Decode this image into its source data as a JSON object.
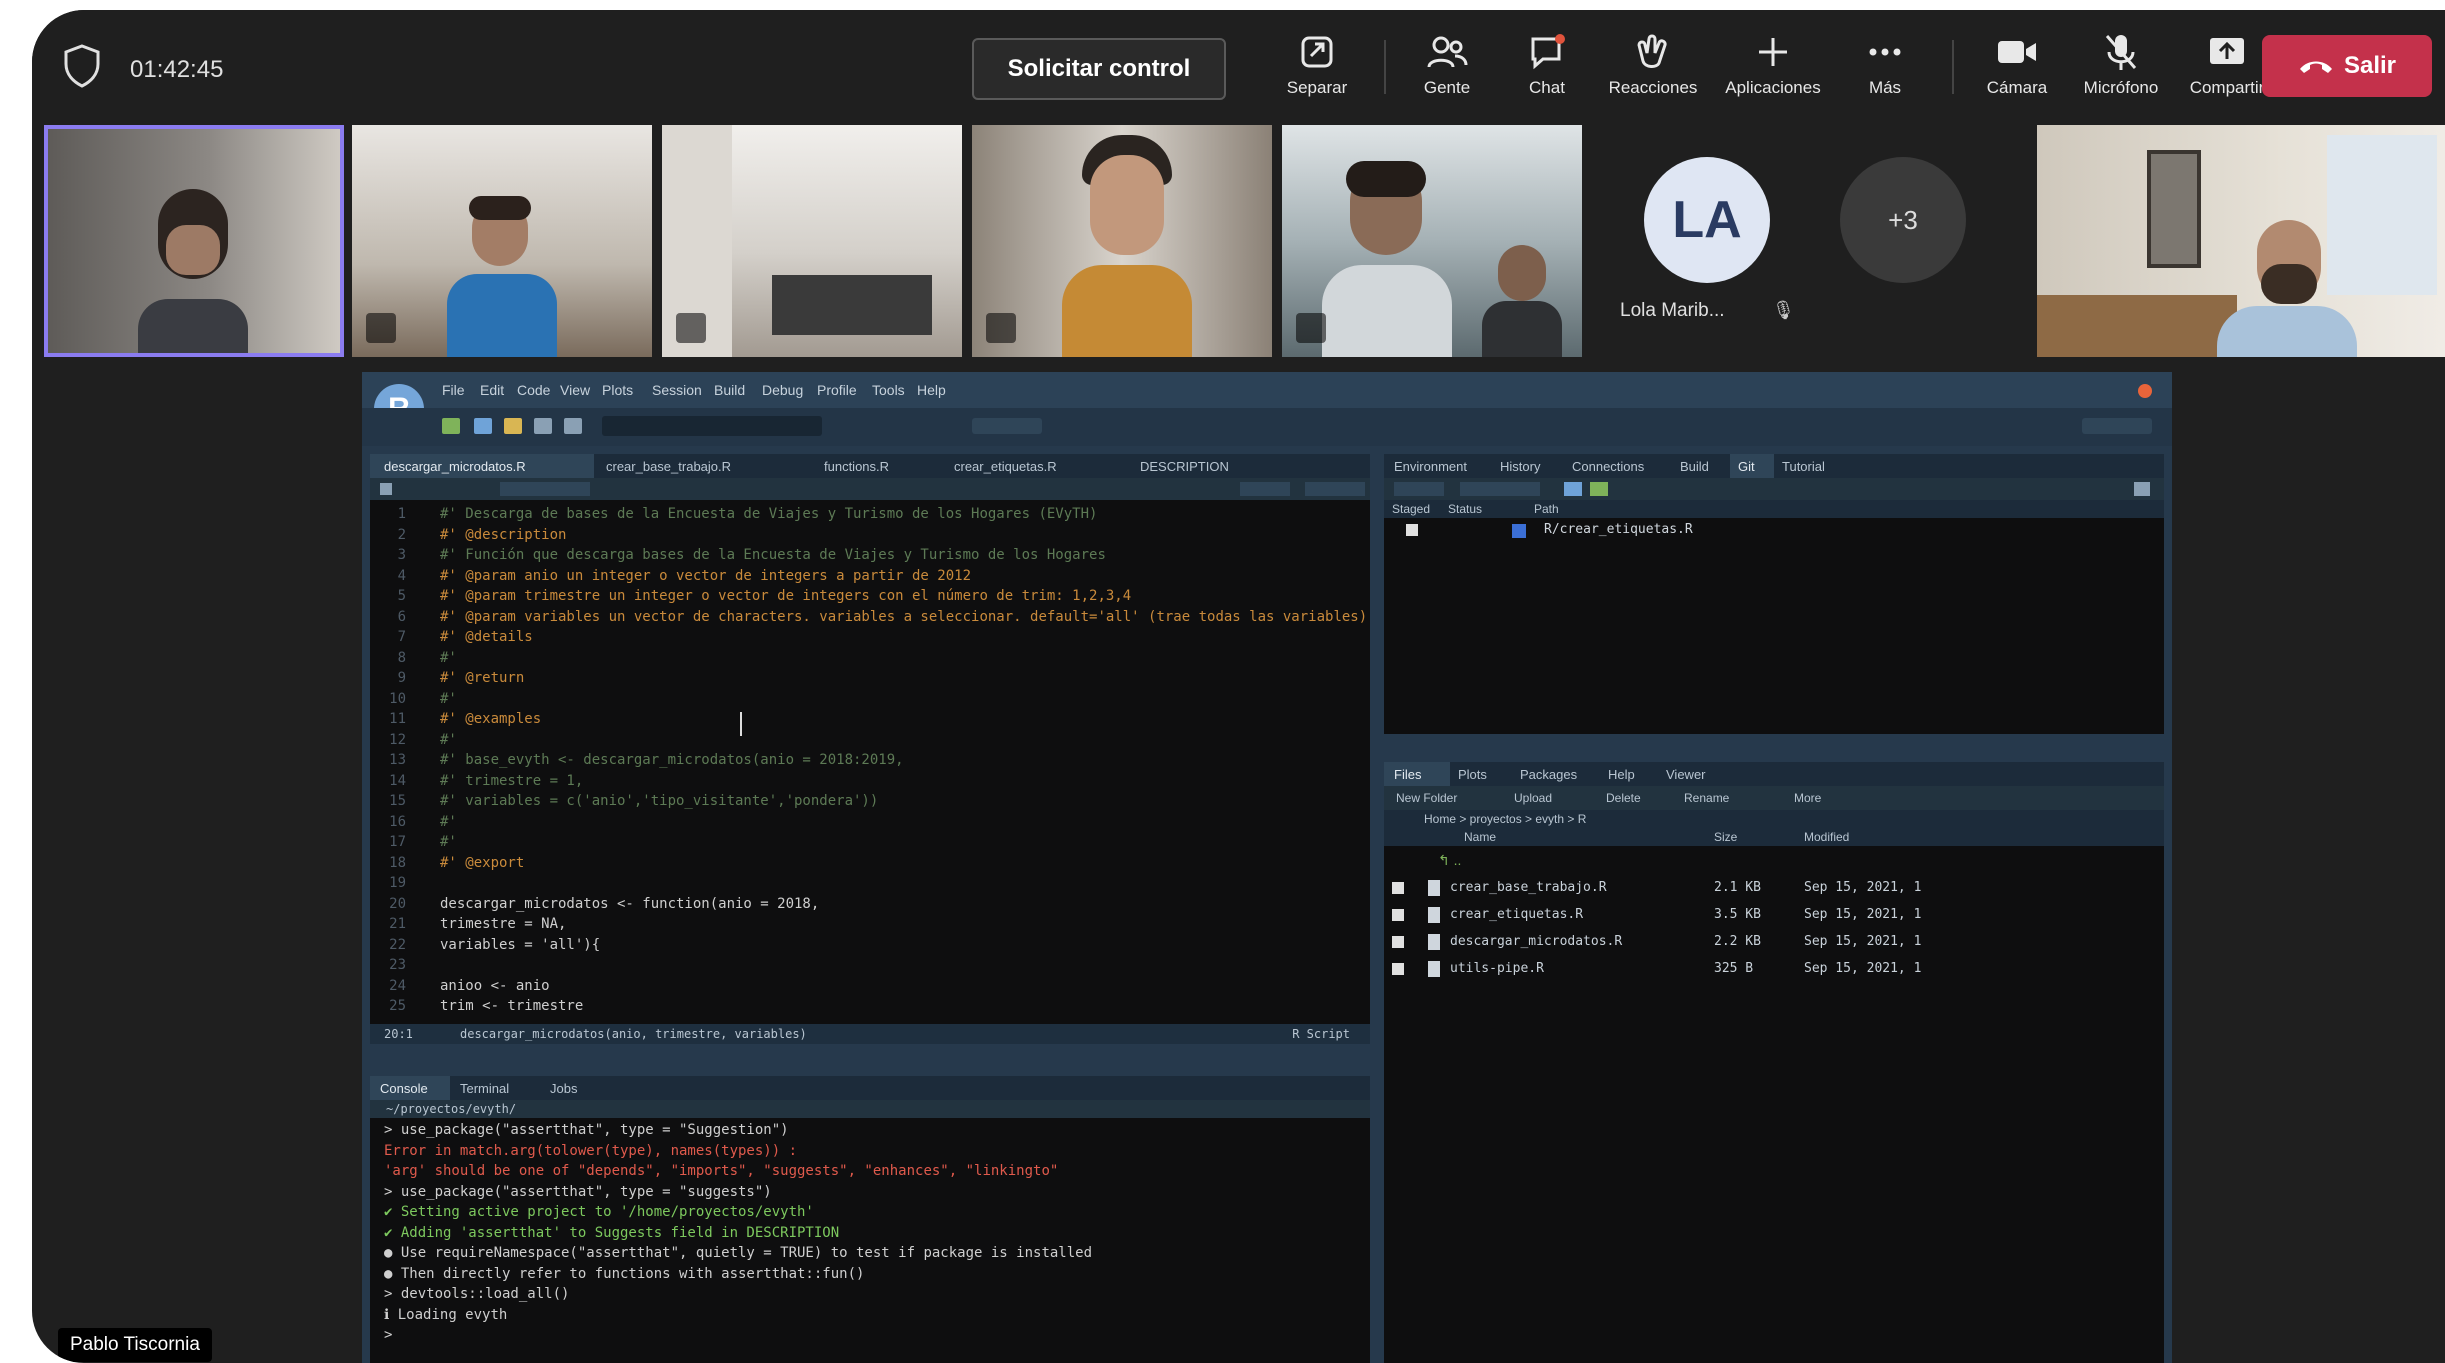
{
  "meeting": {
    "timer": "01:42:45",
    "request_control": "Solicitar control",
    "toolbar": [
      {
        "label": "Separar",
        "icon": "separate-icon"
      },
      {
        "label": "Gente",
        "icon": "people-icon"
      },
      {
        "label": "Chat",
        "icon": "chat-icon"
      },
      {
        "label": "Reacciones",
        "icon": "reactions-icon"
      },
      {
        "label": "Aplicaciones",
        "icon": "apps-icon"
      },
      {
        "label": "Más",
        "icon": "more-icon"
      },
      {
        "label": "Cámara",
        "icon": "camera-icon"
      },
      {
        "label": "Micrófono",
        "icon": "mic-off-icon"
      },
      {
        "label": "Compartir",
        "icon": "share-icon"
      }
    ],
    "leave_label": "Salir",
    "participant_initials": "LA",
    "participant_name": "Lola Marib...",
    "overflow_count": "+3",
    "presenter_name": "Pablo Tiscornia"
  },
  "rstudio": {
    "logo": "R",
    "menu": [
      "File",
      "Edit",
      "Code",
      "View",
      "Plots",
      "Session",
      "Build",
      "Debug",
      "Profile",
      "Tools",
      "Help"
    ],
    "editor_tabs": [
      "descargar_microdatos.R",
      "crear_base_trabajo.R",
      "functions.R",
      "crear_etiquetas.R",
      "DESCRIPTION"
    ],
    "code_lines": [
      {
        "n": "1",
        "cls": "cmt",
        "text": "#' Descarga de bases de la Encuesta de Viajes y Turismo de los Hogares (EVyTH)"
      },
      {
        "n": "2",
        "cls": "tag",
        "text": "#' @description"
      },
      {
        "n": "3",
        "cls": "cmt",
        "text": "#' Función que descarga bases de la Encuesta de Viajes y Turismo de los Hogares"
      },
      {
        "n": "4",
        "cls": "tag",
        "text": "#' @param anio un integer o vector de integers a partir de 2012"
      },
      {
        "n": "5",
        "cls": "tag",
        "text": "#' @param trimestre un integer o vector de integers con el número de trim: 1,2,3,4"
      },
      {
        "n": "6",
        "cls": "tag",
        "text": "#' @param variables un vector de characters. variables a seleccionar. default='all' (trae todas las variables)"
      },
      {
        "n": "7",
        "cls": "tag",
        "text": "#' @details"
      },
      {
        "n": "8",
        "cls": "cmt",
        "text": "#'"
      },
      {
        "n": "9",
        "cls": "tag",
        "text": "#' @return"
      },
      {
        "n": "10",
        "cls": "cmt",
        "text": "#'"
      },
      {
        "n": "11",
        "cls": "tag",
        "text": "#' @examples"
      },
      {
        "n": "12",
        "cls": "cmt",
        "text": "#'"
      },
      {
        "n": "13",
        "cls": "cmt",
        "text": "#' base_evyth <- descargar_microdatos(anio = 2018:2019,"
      },
      {
        "n": "14",
        "cls": "cmt",
        "text": "#'                                     trimestre = 1,"
      },
      {
        "n": "15",
        "cls": "cmt",
        "text": "#'                                     variables = c('anio','tipo_visitante','pondera'))"
      },
      {
        "n": "16",
        "cls": "cmt",
        "text": "#'"
      },
      {
        "n": "17",
        "cls": "cmt",
        "text": "#'"
      },
      {
        "n": "18",
        "cls": "tag",
        "text": "#' @export"
      },
      {
        "n": "19",
        "cls": "norm",
        "text": ""
      },
      {
        "n": "20",
        "cls": "norm",
        "text": "descargar_microdatos <- function(anio = 2018,"
      },
      {
        "n": "21",
        "cls": "norm",
        "text": "                                 trimestre = NA,"
      },
      {
        "n": "22",
        "cls": "norm",
        "text": "                                 variables = 'all'){"
      },
      {
        "n": "23",
        "cls": "norm",
        "text": ""
      },
      {
        "n": "24",
        "cls": "norm",
        "text": "  anioo <- anio"
      },
      {
        "n": "25",
        "cls": "norm",
        "text": "  trim <- trimestre"
      }
    ],
    "editor_status": "descargar_microdatos(anio, trimestre, variables)",
    "editor_status_pos": "20:1",
    "editor_status_type": "R Script",
    "console_tabs": [
      "Console",
      "Terminal",
      "Jobs"
    ],
    "console_path": "~/proyectos/evyth/",
    "console_lines": [
      {
        "cls": "norm",
        "text": "> use_package(\"assertthat\", type = \"Suggestion\")"
      },
      {
        "cls": "err",
        "text": "Error in match.arg(tolower(type), names(types)) :"
      },
      {
        "cls": "err",
        "text": "  'arg' should be one of \"depends\", \"imports\", \"suggests\", \"enhances\", \"linkingto\""
      },
      {
        "cls": "norm",
        "text": "> use_package(\"assertthat\", type = \"suggests\")"
      },
      {
        "cls": "ok",
        "text": "✔ Setting active project to '/home/proyectos/evyth'"
      },
      {
        "cls": "ok",
        "text": "✔ Adding 'assertthat' to Suggests field in DESCRIPTION"
      },
      {
        "cls": "norm",
        "text": "● Use requireNamespace(\"assertthat\", quietly = TRUE) to test if package is installed"
      },
      {
        "cls": "norm",
        "text": "● Then directly refer to functions with assertthat::fun()"
      },
      {
        "cls": "norm",
        "text": "> devtools::load_all()"
      },
      {
        "cls": "norm",
        "text": "ℹ Loading evyth"
      },
      {
        "cls": "norm",
        "text": ">"
      }
    ],
    "env_tabs": [
      "Environment",
      "History",
      "Connections",
      "Build",
      "Git",
      "Tutorial"
    ],
    "env_headers": [
      "Staged",
      "Status",
      "Path"
    ],
    "env_file": "R/crear_etiquetas.R",
    "files_tabs": [
      "Files",
      "Plots",
      "Packages",
      "Help",
      "Viewer"
    ],
    "files_actions": [
      "New Folder",
      "Upload",
      "Delete",
      "Rename",
      "More"
    ],
    "files_path": "Home > proyectos > evyth > R",
    "files_headers": [
      "Name",
      "Size",
      "Modified"
    ],
    "files_rows": [
      {
        "name": "crear_base_trabajo.R",
        "size": "2.1 KB",
        "modified": "Sep 15, 2021, 1"
      },
      {
        "name": "crear_etiquetas.R",
        "size": "3.5 KB",
        "modified": "Sep 15, 2021, 1"
      },
      {
        "name": "descargar_microdatos.R",
        "size": "2.2 KB",
        "modified": "Sep 15, 2021, 1"
      },
      {
        "name": "utils-pipe.R",
        "size": "325 B",
        "modified": "Sep 15, 2021, 1"
      }
    ]
  }
}
